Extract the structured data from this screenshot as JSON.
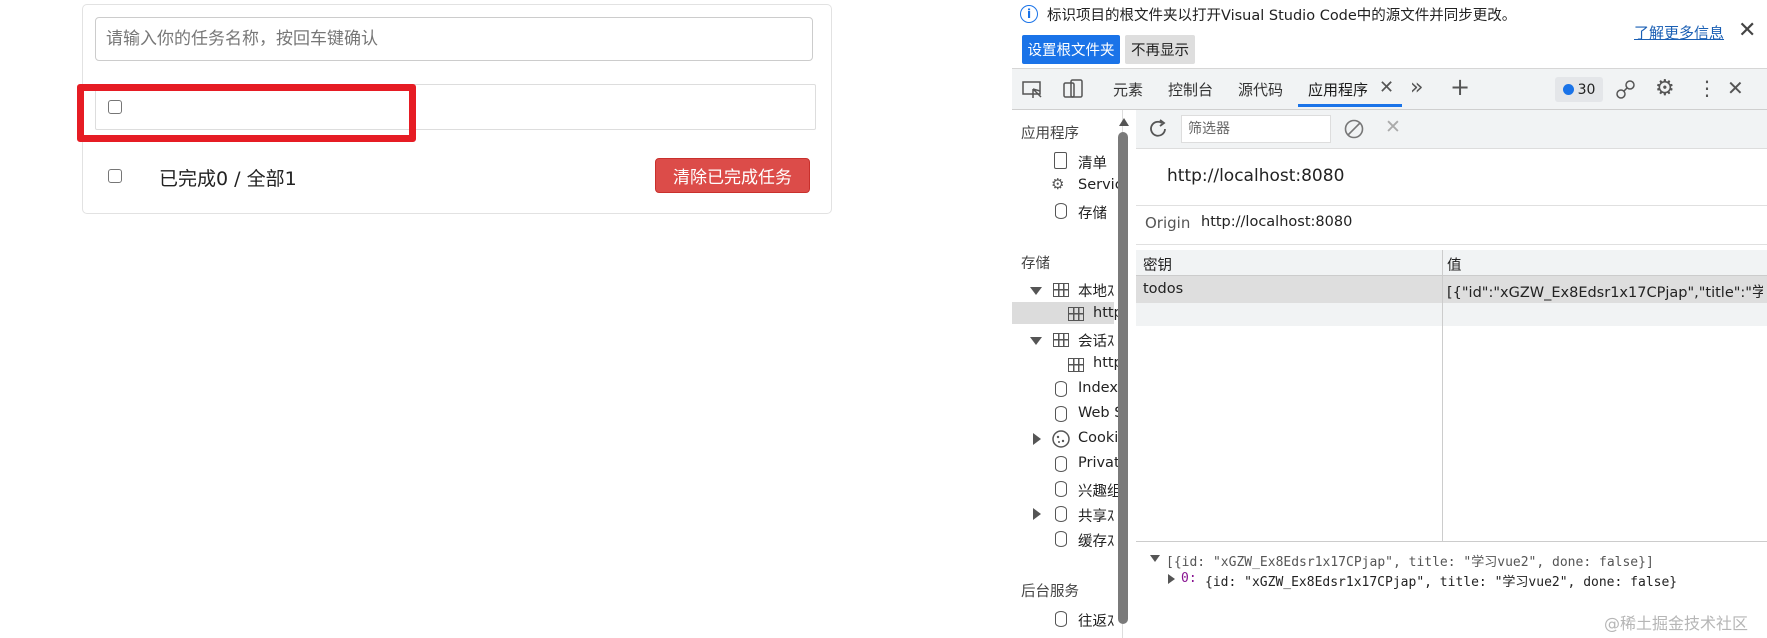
{
  "todo": {
    "input_placeholder": "请输入你的任务名称，按回车键确认",
    "item_title": "",
    "footer_label": "已完成0 / 全部1",
    "clear_button": "清除已完成任务"
  },
  "devtools": {
    "info_bar": {
      "message": "标识项目的根文件夹以打开Visual Studio Code中的源文件并同步更改。",
      "learn_more": "了解更多信息",
      "set_root_button": "设置根文件夹",
      "dont_show_button": "不再显示"
    },
    "tabs": [
      "元素",
      "控制台",
      "源代码",
      "应用程序"
    ],
    "active_tab": "应用程序",
    "issues_count": "30",
    "sidebar": {
      "app_section": "应用程序",
      "app_items": [
        "清单",
        "Servic",
        "存储"
      ],
      "storage_section": "存储",
      "storage_items": [
        "本地ｽ",
        "http",
        "会话ｽ",
        "http",
        "Index",
        "Web S",
        "Cooki",
        "Privat",
        "兴趣组",
        "共享ｽ",
        "缓存ｽ"
      ],
      "bg_section": "后台服务",
      "bg_items": [
        "往返ｽ"
      ]
    },
    "filter_placeholder": "筛选器",
    "url_heading": "http://localhost:8080",
    "origin_label": "Origin",
    "origin_value": "http://localhost:8080",
    "table": {
      "key_header": "密钥",
      "value_header": "值",
      "rows": [
        {
          "key": "todos",
          "value": "[{\"id\":\"xGZW_Ex8Edsr1x17CPjap\",\"title\":\"学..."
        }
      ]
    },
    "console": {
      "line1": "[{id: \"xGZW_Ex8Edsr1x17CPjap\", title: \"学习vue2\", done: false}]",
      "line2_index": "0:",
      "line2": "{id: \"xGZW_Ex8Edsr1x17CPjap\", title: \"学习vue2\", done: false}"
    }
  },
  "watermark": "@稀土掘金技术社区",
  "colors": {
    "highlight": "#e61c24",
    "danger_button": "#dc4c49",
    "accent": "#1a73e8"
  }
}
